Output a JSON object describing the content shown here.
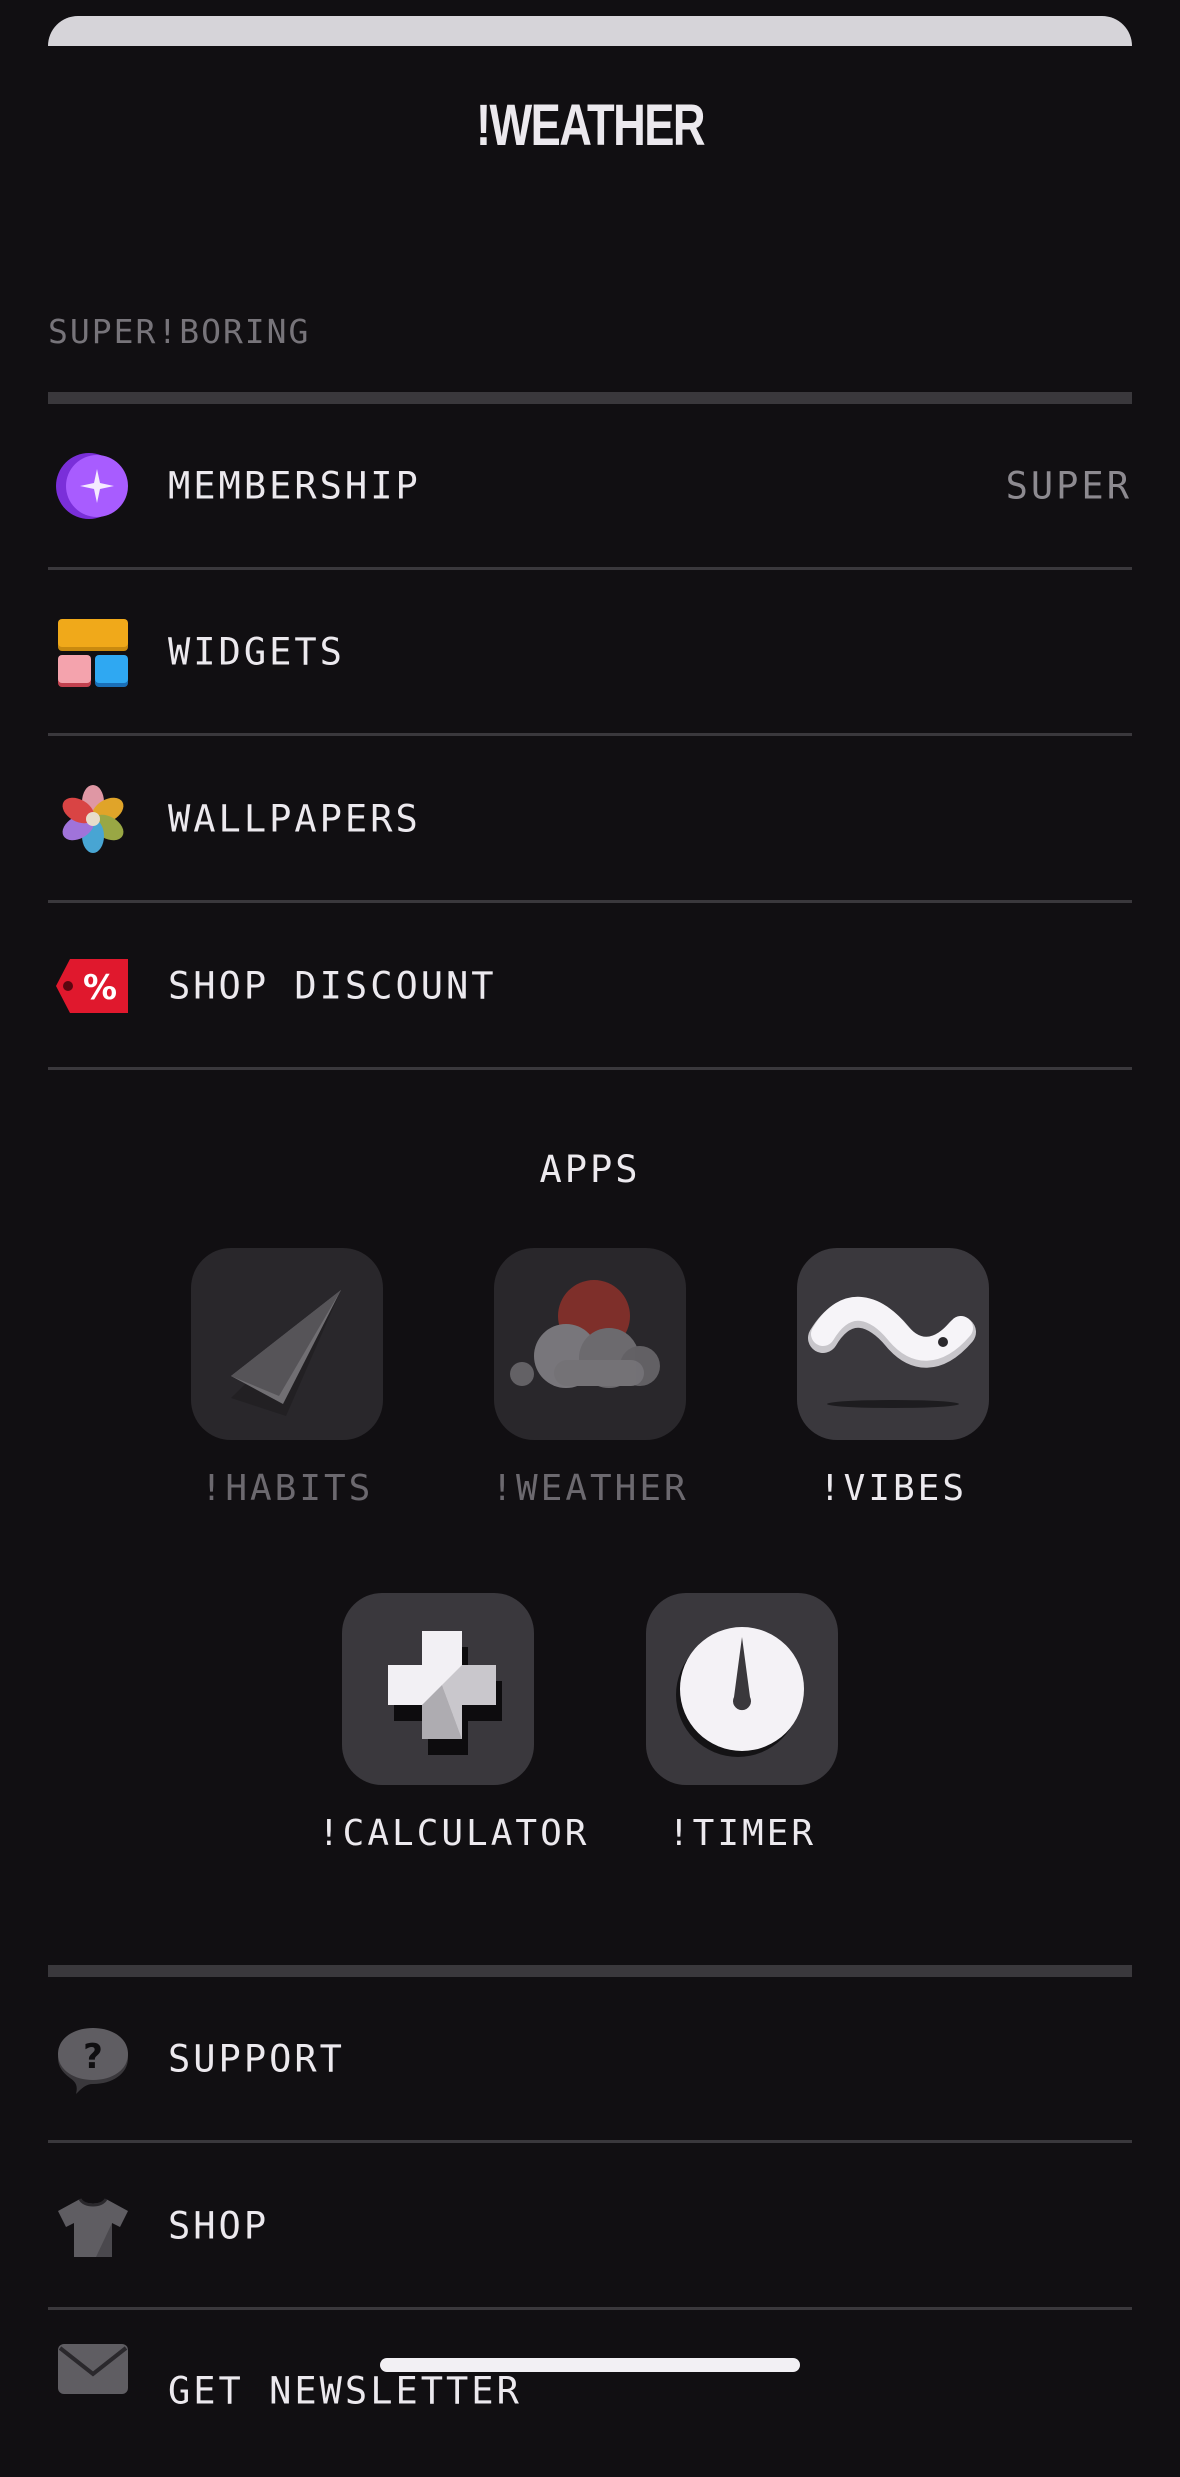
{
  "app_title": "!WEATHER",
  "section": {
    "label": "SUPER!BORING"
  },
  "menu": [
    {
      "label": "MEMBERSHIP",
      "value": "SUPER",
      "icon": "membership-sparkle-icon"
    },
    {
      "label": "WIDGETS",
      "icon": "widgets-icon"
    },
    {
      "label": "WALLPAPERS",
      "icon": "wallpapers-flower-icon"
    },
    {
      "label": "SHOP DISCOUNT",
      "icon": "discount-tag-icon"
    }
  ],
  "apps": {
    "title": "APPS",
    "items": [
      {
        "name": "!HABITS",
        "icon": "paper-plane-icon",
        "state": "dimmed"
      },
      {
        "name": "!WEATHER",
        "icon": "cloud-sun-icon",
        "state": "dimmed"
      },
      {
        "name": "!VIBES",
        "icon": "wave-icon",
        "state": "active"
      },
      {
        "name": "!CALCULATOR",
        "icon": "plus-icon",
        "state": "active"
      },
      {
        "name": "!TIMER",
        "icon": "timer-dial-icon",
        "state": "active"
      }
    ]
  },
  "bottom_menu": [
    {
      "label": "SUPPORT",
      "icon": "question-bubble-icon"
    },
    {
      "label": "SHOP",
      "icon": "tshirt-icon"
    },
    {
      "label": "GET NEWSLETTER",
      "icon": "envelope-icon"
    }
  ],
  "colors": {
    "background": "#110f12",
    "divider": "#3a383c",
    "membership": "#9b4dff",
    "discount": "#e0182d",
    "widget_yellow": "#f0a91a",
    "widget_pink": "#f4a3ad",
    "widget_blue": "#2fa8f2"
  }
}
